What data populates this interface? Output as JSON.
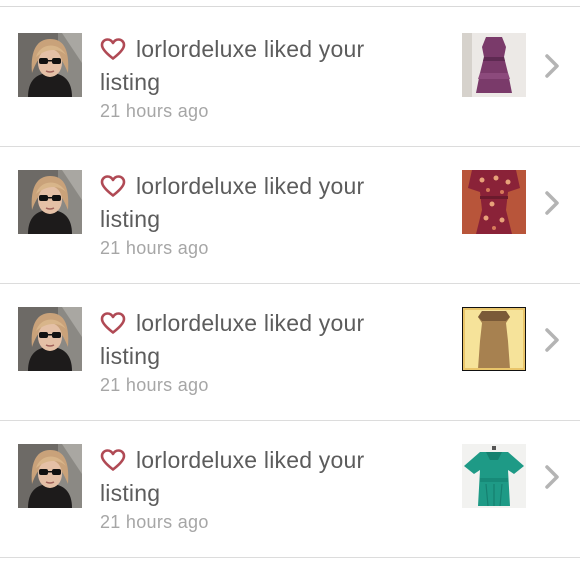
{
  "notifications": [
    {
      "user": "lorlordeluxe",
      "action": "liked your",
      "object": "listing",
      "time": "21 hours ago",
      "avatar_icon": "user-avatar-photo",
      "heart_icon": "heart-icon",
      "thumb": {
        "item": "purple dress",
        "bg": "#ece9e6",
        "color": "#7a3a6a"
      }
    },
    {
      "user": "lorlordeluxe",
      "action": "liked your",
      "object": "listing",
      "time": "21 hours ago",
      "avatar_icon": "user-avatar-photo",
      "heart_icon": "heart-icon",
      "thumb": {
        "item": "red floral dress",
        "bg": "#b8553a",
        "color": "#8a2238"
      }
    },
    {
      "user": "lorlordeluxe",
      "action": "liked your",
      "object": "listing",
      "time": "21 hours ago",
      "avatar_icon": "user-avatar-photo",
      "heart_icon": "heart-icon",
      "thumb": {
        "item": "tan dress",
        "bg": "#f6e39a",
        "color": "#a78150"
      }
    },
    {
      "user": "lorlordeluxe",
      "action": "liked your",
      "object": "listing",
      "time": "21 hours ago",
      "avatar_icon": "user-avatar-photo",
      "heart_icon": "heart-icon",
      "thumb": {
        "item": "teal blouse",
        "bg": "#f2f2f0",
        "color": "#1e9a86"
      }
    }
  ],
  "colors": {
    "heart": "#b04a55",
    "text": "#5c5c5c",
    "time": "#a6a6a6",
    "chevron": "#b4b4b4",
    "divider": "#dcdcdc"
  }
}
